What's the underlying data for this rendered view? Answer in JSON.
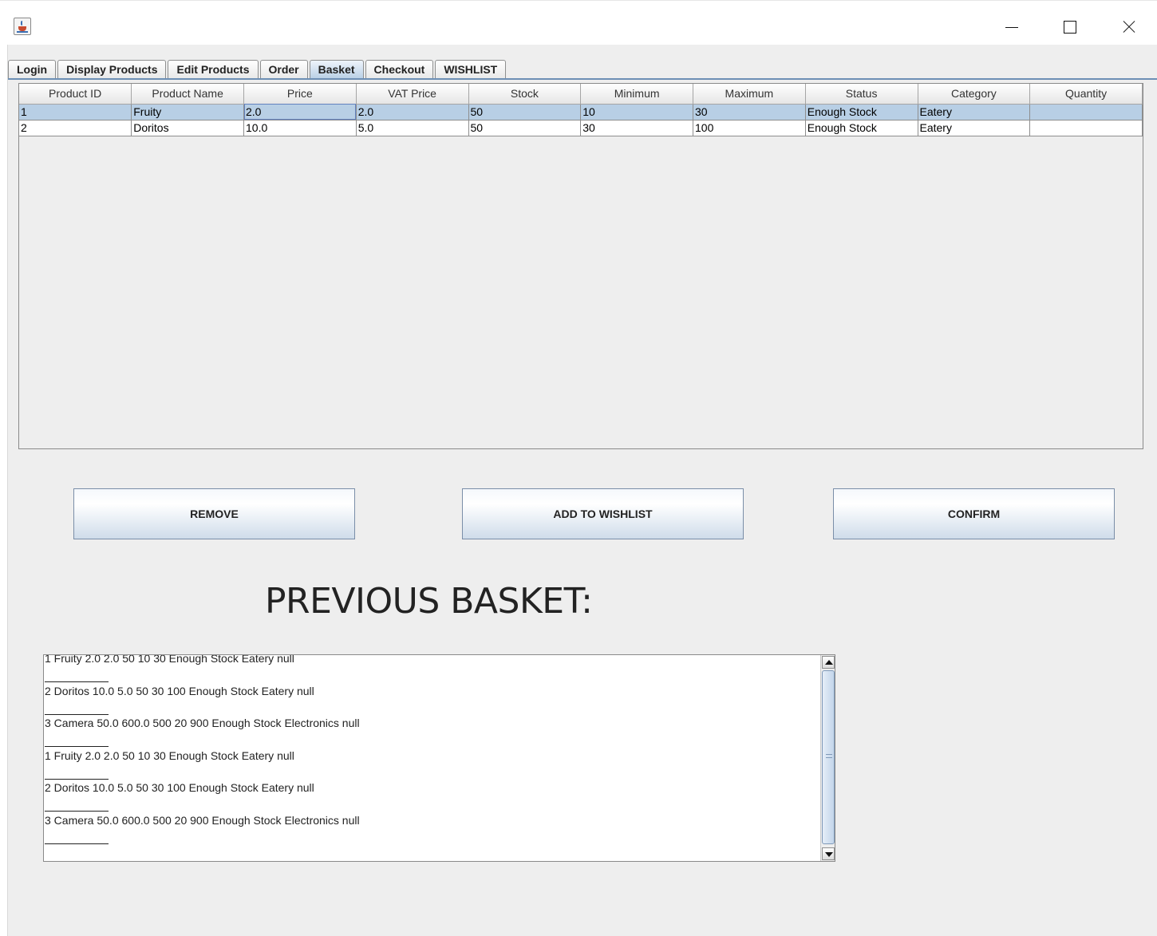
{
  "window": {
    "icon": "java-cup-icon"
  },
  "tabs": [
    {
      "label": "Login"
    },
    {
      "label": "Display Products"
    },
    {
      "label": "Edit Products"
    },
    {
      "label": "Order"
    },
    {
      "label": "Basket",
      "active": true
    },
    {
      "label": "Checkout"
    },
    {
      "label": "WISHLIST"
    }
  ],
  "table": {
    "columns": [
      "Product ID",
      "Product Name",
      "Price",
      "VAT Price",
      "Stock",
      "Minimum",
      "Maximum",
      "Status",
      "Category",
      "Quantity"
    ],
    "rows": [
      {
        "cells": [
          "1",
          "Fruity",
          "2.0",
          "2.0",
          "50",
          "10",
          "30",
          "Enough Stock",
          "Eatery",
          ""
        ],
        "selected": true
      },
      {
        "cells": [
          "2",
          "Doritos",
          "10.0",
          "5.0",
          "50",
          "30",
          "100",
          "Enough Stock",
          "Eatery",
          ""
        ],
        "selected": false
      }
    ]
  },
  "buttons": {
    "remove": "REMOVE",
    "add_to_wishlist": "ADD TO WISHLIST",
    "confirm": "CONFIRM"
  },
  "heading": "PREVIOUS BASKET:",
  "previous_basket": [
    "1 Fruity 2.0 2.0 50 10 30 Enough Stock Eatery null",
    "2 Doritos 10.0 5.0 50 30 100 Enough Stock Eatery null",
    "3 Camera 50.0 600.0 500 20 900 Enough Stock Electronics null",
    "1 Fruity 2.0 2.0 50 10 30 Enough Stock Eatery null",
    "2 Doritos 10.0 5.0 50 30 100 Enough Stock Eatery null",
    "3 Camera 50.0 600.0 500 20 900 Enough Stock Electronics null"
  ],
  "colors": {
    "selection": "#b8cfe5",
    "background": "#eeeeee",
    "tab_underline": "#6d8fb5"
  }
}
